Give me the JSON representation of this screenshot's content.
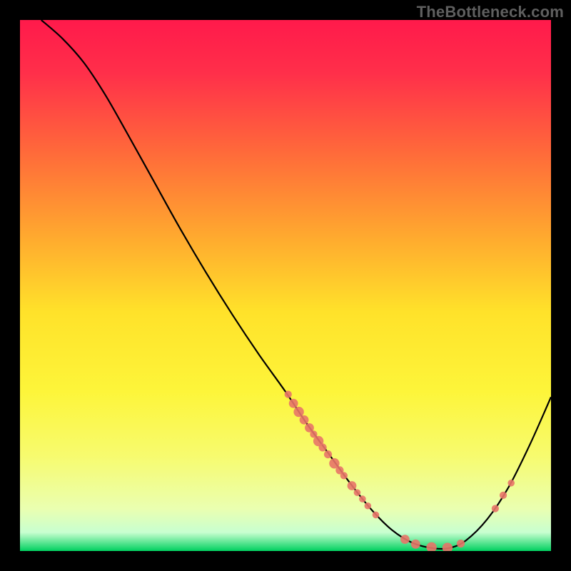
{
  "watermark": "TheBottleneck.com",
  "chart_data": {
    "type": "line",
    "title": "",
    "xlabel": "",
    "ylabel": "",
    "xlim": [
      0,
      100
    ],
    "ylim": [
      0,
      100
    ],
    "grid": false,
    "background_gradient": {
      "stops": [
        {
          "offset": 0.0,
          "color": "#ff1a4b"
        },
        {
          "offset": 0.1,
          "color": "#ff2f4a"
        },
        {
          "offset": 0.25,
          "color": "#ff6a3a"
        },
        {
          "offset": 0.4,
          "color": "#ffa62f"
        },
        {
          "offset": 0.55,
          "color": "#ffe22a"
        },
        {
          "offset": 0.7,
          "color": "#fdf53a"
        },
        {
          "offset": 0.82,
          "color": "#f7fb6e"
        },
        {
          "offset": 0.92,
          "color": "#eaffb0"
        },
        {
          "offset": 0.965,
          "color": "#c8ffd0"
        },
        {
          "offset": 1.0,
          "color": "#00d060"
        }
      ]
    },
    "curve": [
      {
        "x": 4,
        "y": 100
      },
      {
        "x": 8,
        "y": 96.5
      },
      {
        "x": 12,
        "y": 92
      },
      {
        "x": 16,
        "y": 86
      },
      {
        "x": 20,
        "y": 79
      },
      {
        "x": 25,
        "y": 70
      },
      {
        "x": 30,
        "y": 61
      },
      {
        "x": 35,
        "y": 52.5
      },
      {
        "x": 40,
        "y": 44.5
      },
      {
        "x": 45,
        "y": 37
      },
      {
        "x": 50,
        "y": 30
      },
      {
        "x": 54,
        "y": 24
      },
      {
        "x": 58,
        "y": 18.5
      },
      {
        "x": 62,
        "y": 13
      },
      {
        "x": 66,
        "y": 8
      },
      {
        "x": 70,
        "y": 4
      },
      {
        "x": 74,
        "y": 1.5
      },
      {
        "x": 78,
        "y": 0.5
      },
      {
        "x": 81,
        "y": 0.6
      },
      {
        "x": 84,
        "y": 2
      },
      {
        "x": 88,
        "y": 6
      },
      {
        "x": 92,
        "y": 12
      },
      {
        "x": 96,
        "y": 20
      },
      {
        "x": 100,
        "y": 29
      }
    ],
    "scatter": [
      {
        "x": 50.5,
        "y": 29.5,
        "r": 3.2
      },
      {
        "x": 51.5,
        "y": 27.8,
        "r": 4.0
      },
      {
        "x": 52.5,
        "y": 26.2,
        "r": 4.5
      },
      {
        "x": 53.5,
        "y": 24.7,
        "r": 4.0
      },
      {
        "x": 54.5,
        "y": 23.2,
        "r": 4.0
      },
      {
        "x": 55.3,
        "y": 22.0,
        "r": 3.2
      },
      {
        "x": 56.2,
        "y": 20.7,
        "r": 4.5
      },
      {
        "x": 57.0,
        "y": 19.5,
        "r": 3.5
      },
      {
        "x": 58.0,
        "y": 18.2,
        "r": 3.5
      },
      {
        "x": 59.2,
        "y": 16.5,
        "r": 4.5
      },
      {
        "x": 60.2,
        "y": 15.2,
        "r": 3.5
      },
      {
        "x": 61.0,
        "y": 14.2,
        "r": 3.2
      },
      {
        "x": 62.5,
        "y": 12.3,
        "r": 4.0
      },
      {
        "x": 63.5,
        "y": 11.0,
        "r": 3.0
      },
      {
        "x": 64.5,
        "y": 9.8,
        "r": 3.0
      },
      {
        "x": 65.5,
        "y": 8.5,
        "r": 3.0
      },
      {
        "x": 67.0,
        "y": 6.8,
        "r": 3.0
      },
      {
        "x": 72.5,
        "y": 2.2,
        "r": 4.0
      },
      {
        "x": 74.5,
        "y": 1.3,
        "r": 4.0
      },
      {
        "x": 77.5,
        "y": 0.7,
        "r": 4.5
      },
      {
        "x": 80.5,
        "y": 0.6,
        "r": 4.5
      },
      {
        "x": 83.0,
        "y": 1.4,
        "r": 3.5
      },
      {
        "x": 89.5,
        "y": 8.0,
        "r": 3.2
      },
      {
        "x": 91.0,
        "y": 10.5,
        "r": 3.2
      },
      {
        "x": 92.5,
        "y": 12.8,
        "r": 3.0
      }
    ],
    "curve_color": "#000000",
    "scatter_color": "#e87468"
  }
}
